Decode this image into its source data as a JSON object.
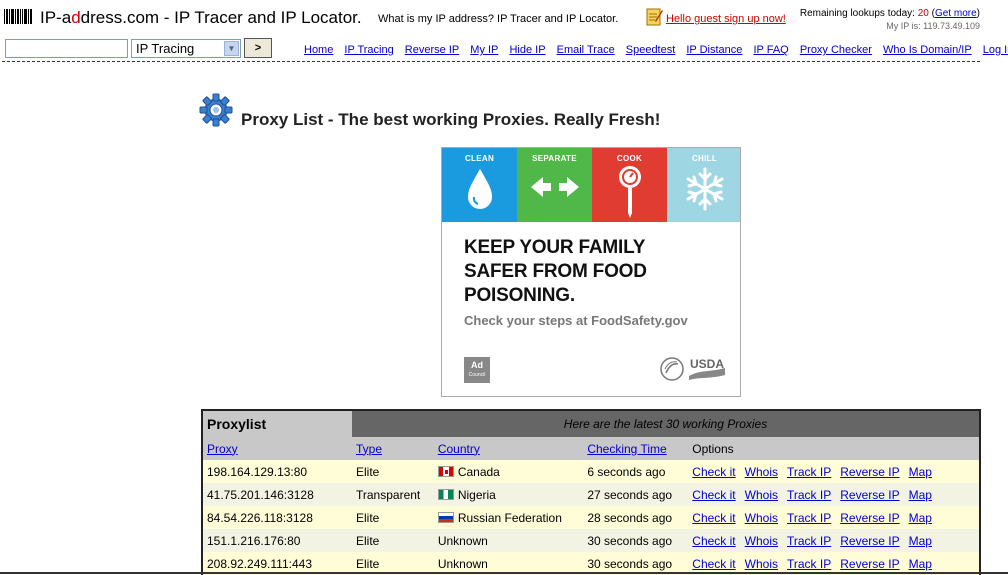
{
  "header": {
    "logo_a": "IP-a",
    "logo_d": "d",
    "logo_rest": "dress.com - IP Tracer and IP Locator.",
    "tagline": "What is my IP address? IP Tracer and IP Locator.",
    "signup_link": "Hello guest sign up now!",
    "lookups_label": "Remaining lookups today:",
    "lookups_count": "20",
    "lookups_open": " (",
    "get_more": "Get more",
    "lookups_close": ")",
    "my_ip": "My IP is: 119.73.49.109"
  },
  "search": {
    "input_value": "",
    "select_value": "IP Tracing",
    "go_label": ">"
  },
  "nav": [
    {
      "label": "Home"
    },
    {
      "label": "IP Tracing"
    },
    {
      "label": "Reverse IP"
    },
    {
      "label": "My IP"
    },
    {
      "label": "Hide IP"
    },
    {
      "label": "Email Trace"
    },
    {
      "label": "Speedtest"
    },
    {
      "label": "IP Distance"
    },
    {
      "label": "IP FAQ"
    },
    {
      "label": "Proxy Checker"
    },
    {
      "label": "Who Is Domain/IP"
    },
    {
      "label": "Log In"
    }
  ],
  "page": {
    "title": "Proxy List - The best working Proxies. Really Fresh!"
  },
  "ad": {
    "panels": [
      {
        "label": "CLEAN",
        "color": "#1a9be0"
      },
      {
        "label": "SEPARATE",
        "color": "#4fb848"
      },
      {
        "label": "COOK",
        "color": "#e03c31"
      },
      {
        "label": "CHILL",
        "color": "#9ed6e3"
      }
    ],
    "headline_1": "KEEP YOUR FAMILY",
    "headline_2": "SAFER FROM FOOD",
    "headline_3": "POISONING.",
    "sub": "Check your steps at FoodSafety.gov",
    "adcouncil_1": "Ad",
    "adcouncil_2": "Council",
    "usda": "USDA"
  },
  "table": {
    "title": "Proxylist",
    "subtitle": "Here are the latest 30 working Proxies",
    "columns": [
      "Proxy",
      "Type",
      "Country",
      "Checking Time",
      "Options"
    ],
    "options": [
      "Check it",
      "Whois",
      "Track IP",
      "Reverse IP",
      "Map"
    ],
    "rows": [
      {
        "proxy": "198.164.129.13:80",
        "type": "Elite",
        "country": "Canada",
        "flag": "canada",
        "time": "6 seconds ago"
      },
      {
        "proxy": "41.75.201.146:3128",
        "type": "Transparent",
        "country": "Nigeria",
        "flag": "nigeria",
        "time": "27 seconds ago"
      },
      {
        "proxy": "84.54.226.118:3128",
        "type": "Elite",
        "country": "Russian Federation",
        "flag": "russia",
        "time": "28 seconds ago"
      },
      {
        "proxy": "151.1.216.176:80",
        "type": "Elite",
        "country": "Unknown",
        "flag": "",
        "time": "30 seconds ago"
      },
      {
        "proxy": "208.92.249.111:443",
        "type": "Elite",
        "country": "Unknown",
        "flag": "",
        "time": "30 seconds ago"
      }
    ]
  },
  "colors": {
    "link": "#0000cc",
    "signup": "#cc0000",
    "row_odd": "#fffdd8",
    "row_even": "#f3f3e4",
    "table_header_dark": "#666666"
  }
}
